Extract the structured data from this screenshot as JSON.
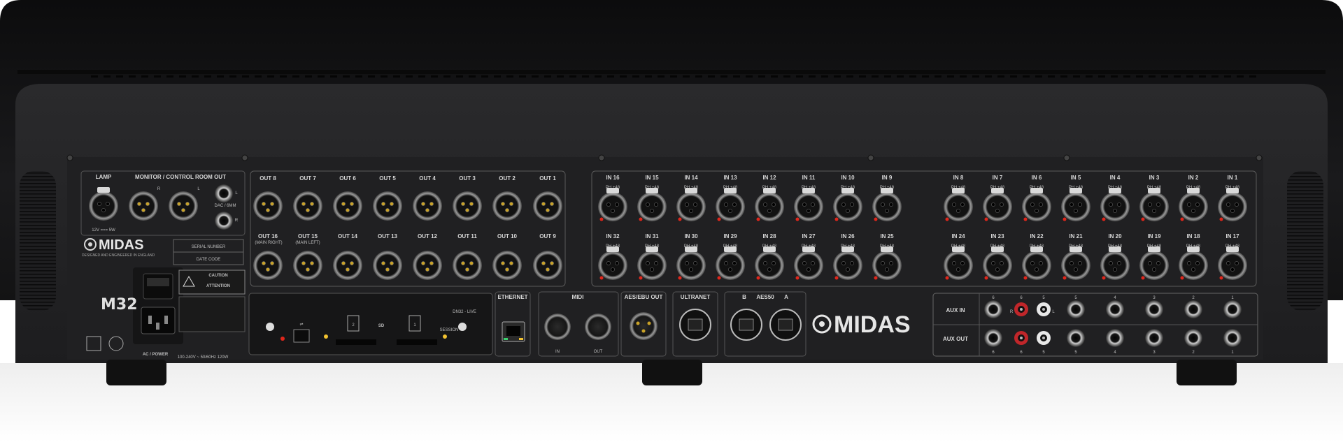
{
  "brand": {
    "name": "MIDAS",
    "model": "M32",
    "tagline": "DESIGNED AND ENGINEERED IN ENGLAND"
  },
  "left_section": {
    "lamp_label": "LAMP",
    "lamp_spec": "12V === 5W",
    "monitor_label": "MONITOR / CONTROL ROOM OUT",
    "monitor_lr": [
      "R",
      "L"
    ],
    "phones_lr": [
      "L",
      "R"
    ],
    "phones_label": "DAC / 6MM",
    "serial_label": "SERIAL NUMBER",
    "date_label": "DATE CODE",
    "caution_title": "CAUTION",
    "attention_title": "ATTENTION",
    "power_label": "AC / POWER",
    "power_spec": "100-240V ~ 50/60Hz 120W"
  },
  "outputs": {
    "row1": [
      "OUT 8",
      "OUT 7",
      "OUT 6",
      "OUT 5",
      "OUT 4",
      "OUT 3",
      "OUT 2",
      "OUT 1"
    ],
    "row2": [
      "OUT 16",
      "OUT 15",
      "OUT 14",
      "OUT 13",
      "OUT 12",
      "OUT 11",
      "OUT 10",
      "OUT 9"
    ],
    "out16_note": "(MAIN RIGHT)",
    "out15_note": "(MAIN LEFT)"
  },
  "inputs": {
    "row1_a": [
      "IN 16",
      "IN 15",
      "IN 14",
      "IN 13",
      "IN 12",
      "IN 11",
      "IN 10",
      "IN 9"
    ],
    "row1_b": [
      "IN 8",
      "IN 7",
      "IN 6",
      "IN 5",
      "IN 4",
      "IN 3",
      "IN 2",
      "IN 1"
    ],
    "row2_a": [
      "IN 32",
      "IN 31",
      "IN 30",
      "IN 29",
      "IN 28",
      "IN 27",
      "IN 26",
      "IN 25"
    ],
    "row2_b": [
      "IN 24",
      "IN 23",
      "IN 22",
      "IN 21",
      "IN 20",
      "IN 19",
      "IN 18",
      "IN 17"
    ],
    "phantom_tag": "PH.+48"
  },
  "card_slot": {
    "label": "DN32 - LIVE",
    "slots": [
      "2",
      "1"
    ],
    "sd_label": "SD",
    "session_label": "SESSION"
  },
  "ethernet": {
    "label": "ETHERNET"
  },
  "midi": {
    "label": "MIDI",
    "in": "IN",
    "out": "OUT"
  },
  "aes_ebu": {
    "label": "AES/EBU OUT"
  },
  "ultranet": {
    "label": "ULTRANET"
  },
  "aes50": {
    "label": "AES50",
    "ports": [
      "B",
      "A"
    ]
  },
  "aux": {
    "in_label": "AUX IN",
    "out_label": "AUX OUT",
    "channels": [
      "6",
      "6",
      "5",
      "5",
      "4",
      "3",
      "2",
      "1"
    ],
    "rca_lr": [
      "R",
      "L"
    ]
  },
  "colors": {
    "chassis": "#1c1c1e",
    "panel": "#232325",
    "led_red": "#e0261b",
    "led_yellow": "#f2c230",
    "eth_green": "#3bd16f"
  }
}
